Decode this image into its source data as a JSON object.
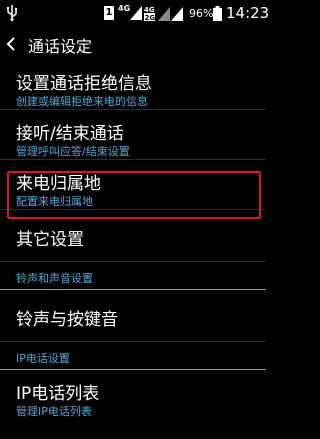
{
  "status_bar": {
    "sim_slot": "1",
    "network_1": "4G",
    "network_2": "4G",
    "network_2b": "2G",
    "battery_percent": "96%",
    "time": "14:23"
  },
  "action_bar": {
    "title": "通话设定"
  },
  "items": [
    {
      "label": "设置通话拒绝信息",
      "sub": "创建或编辑拒绝来电的信息"
    },
    {
      "label": "接听/结束通话",
      "sub": "管理呼叫应答/结束设置"
    },
    {
      "label": "来电归属地",
      "sub": "配置来电归属地"
    },
    {
      "label": "其它设置"
    },
    {
      "section": "铃声和声音设置"
    },
    {
      "label": "铃声与按键音"
    },
    {
      "section": "IP电话设置"
    },
    {
      "label": "IP电话列表",
      "sub": "管理IP电话列表"
    }
  ],
  "colors": {
    "accent": "#4fa8d8",
    "highlight": "#e0141f",
    "background": "#000000"
  }
}
